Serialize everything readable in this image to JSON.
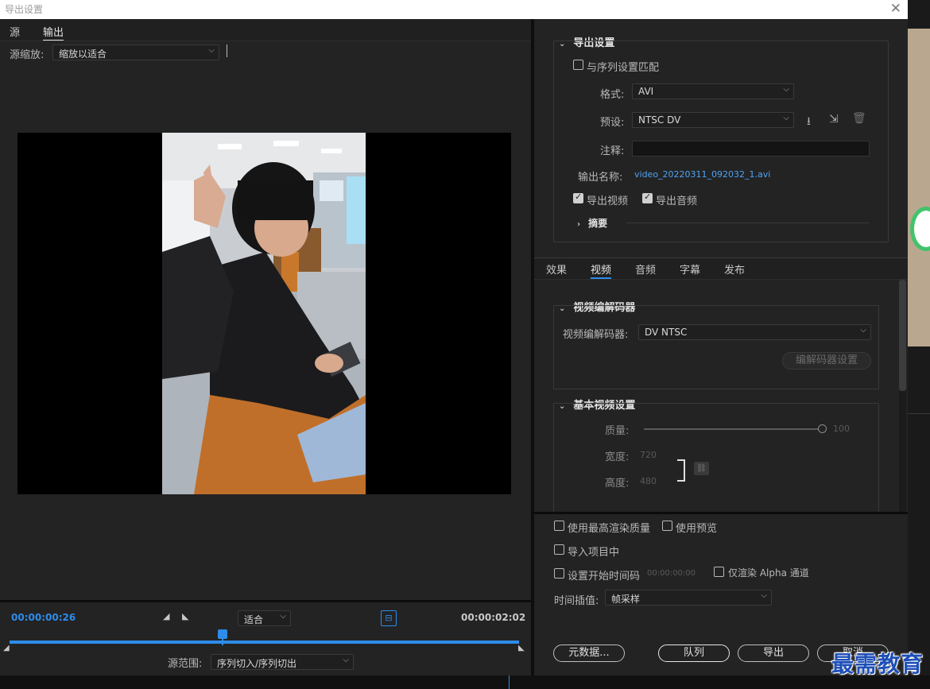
{
  "window": {
    "title": "导出设置",
    "close_glyph": "✕"
  },
  "source_tabs": [
    "源",
    "输出"
  ],
  "source_zoom": {
    "label": "源缩放:",
    "value": "缩放以适合"
  },
  "playback": {
    "current_time": "00:00:00:26",
    "fit_value": "适合",
    "duration": "00:00:02:02",
    "range_label": "源范围:",
    "range_value": "序列切入/序列切出"
  },
  "export_settings": {
    "section_title": "导出设置",
    "match_sequence": "与序列设置匹配",
    "format_label": "格式:",
    "format_value": "AVI",
    "preset_label": "预设:",
    "preset_value": "NTSC DV",
    "comment_label": "注释:",
    "output_name_label": "输出名称:",
    "output_name_value": "video_20220311_092032_1.avi",
    "export_video": "导出视频",
    "export_audio": "导出音频",
    "summary": "摘要"
  },
  "settings_tabs": [
    "效果",
    "视频",
    "音频",
    "字幕",
    "发布"
  ],
  "video_codec": {
    "section_title": "视频编解码器",
    "codec_label": "视频编解码器:",
    "codec_value": "DV NTSC",
    "codec_settings_button": "编解码器设置"
  },
  "basic_video": {
    "section_title": "基本视频设置",
    "quality_label": "质量:",
    "quality_value": "100",
    "width_label": "宽度:",
    "width_value": "720",
    "height_label": "高度:",
    "height_value": "480"
  },
  "options": {
    "max_render": "使用最高渲染质量",
    "use_previews": "使用预览",
    "import_project": "导入项目中",
    "set_start_tc": "设置开始时间码",
    "start_tc_value": "00:00:00:00",
    "render_alpha": "仅渲染 Alpha 通道",
    "interp_label": "时间插值:",
    "interp_value": "帧采样"
  },
  "buttons": {
    "metadata": "元数据...",
    "queue": "队列",
    "export": "导出",
    "cancel": "取消"
  },
  "watermark": "最需教育",
  "colors": {
    "accent": "#2d8ceb",
    "link": "#4ea3f5",
    "background": "#232323"
  }
}
